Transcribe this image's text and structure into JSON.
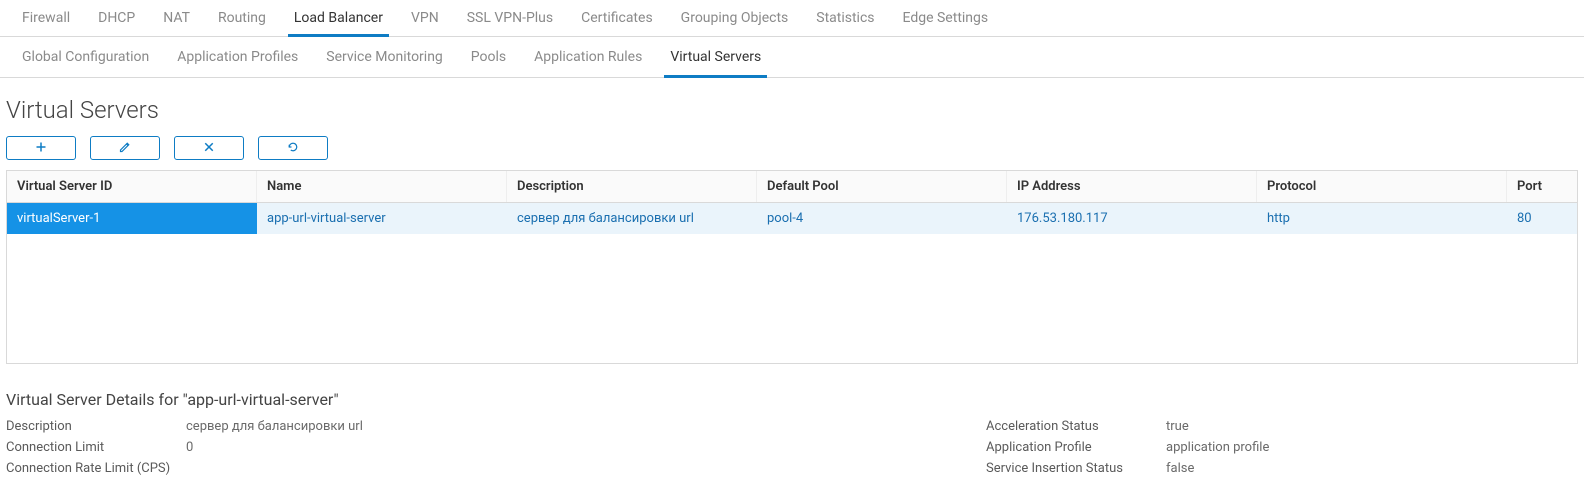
{
  "tabs_primary": {
    "items": [
      "Firewall",
      "DHCP",
      "NAT",
      "Routing",
      "Load Balancer",
      "VPN",
      "SSL VPN-Plus",
      "Certificates",
      "Grouping Objects",
      "Statistics",
      "Edge Settings"
    ],
    "active_index": 4
  },
  "tabs_secondary": {
    "items": [
      "Global Configuration",
      "Application Profiles",
      "Service Monitoring",
      "Pools",
      "Application Rules",
      "Virtual Servers"
    ],
    "active_index": 5
  },
  "page_title": "Virtual Servers",
  "toolbar": {
    "add_label": "add",
    "edit_label": "edit",
    "delete_label": "delete",
    "refresh_label": "refresh"
  },
  "table": {
    "headers": {
      "id": "Virtual Server ID",
      "name": "Name",
      "description": "Description",
      "default_pool": "Default Pool",
      "ip": "IP Address",
      "protocol": "Protocol",
      "port": "Port"
    },
    "rows": [
      {
        "id": "virtualServer-1",
        "name": "app-url-virtual-server",
        "description": "сервер для балансировки url",
        "default_pool": "pool-4",
        "ip": "176.53.180.117",
        "protocol": "http",
        "port": "80"
      }
    ]
  },
  "details": {
    "title": "Virtual Server Details for \"app-url-virtual-server\"",
    "left": {
      "description_label": "Description",
      "description_value": "сервер для балансировки url",
      "conn_limit_label": "Connection Limit",
      "conn_limit_value": "0",
      "conn_rate_limit_label": "Connection Rate Limit (CPS)",
      "conn_rate_limit_value": ""
    },
    "right": {
      "accel_status_label": "Acceleration Status",
      "accel_status_value": "true",
      "app_profile_label": "Application Profile",
      "app_profile_value": "application profile",
      "svc_insertion_label": "Service Insertion Status",
      "svc_insertion_value": "false"
    }
  }
}
